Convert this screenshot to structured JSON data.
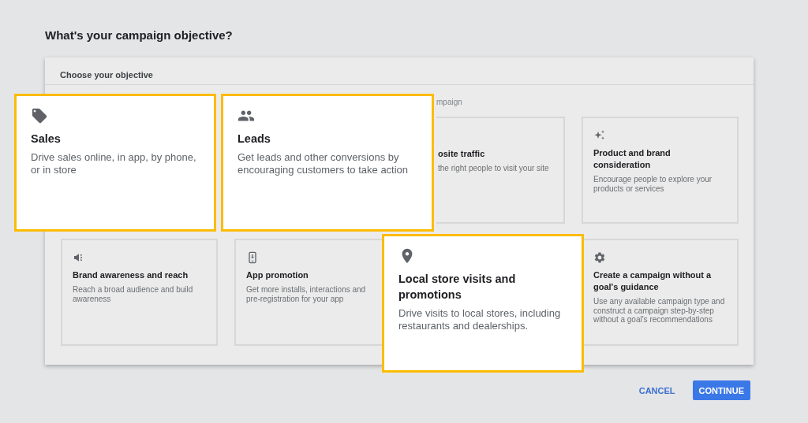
{
  "title": "What's your campaign objective?",
  "panel": {
    "heading": "Choose your objective",
    "subtitle_fragment": "mpaign",
    "cards": [
      {
        "kind": "hidden"
      },
      {
        "kind": "hidden"
      },
      {
        "kind": "partial",
        "title": "osite traffic",
        "description": "the right people to visit your site"
      },
      {
        "kind": "card",
        "title": "Product and brand consideration",
        "description": "Encourage people to explore your products or services"
      },
      {
        "kind": "card",
        "title": "Brand awareness and reach",
        "description": "Reach a broad audience and build awareness"
      },
      {
        "kind": "card",
        "title": "App promotion",
        "description": "Get more installs, interactions and pre-registration for your app"
      },
      {
        "kind": "hidden"
      },
      {
        "kind": "card",
        "title": "Create a campaign without a goal's guidance",
        "description": "Use any available campaign type and construct a campaign step-by-step without a goal's recommendations"
      }
    ]
  },
  "highlighted_cards": [
    {
      "title": "Sales",
      "description": "Drive sales online, in app, by phone, or in store"
    },
    {
      "title": "Leads",
      "description": "Get leads and other conversions by encouraging customers to take action"
    },
    {
      "title": "Local store visits and promotions",
      "description": "Drive visits to local stores, including restaurants and dealerships."
    }
  ],
  "buttons": [
    {
      "kind": "text",
      "label": "CANCEL"
    },
    {
      "kind": "primary",
      "label": "CONTINUE"
    }
  ]
}
